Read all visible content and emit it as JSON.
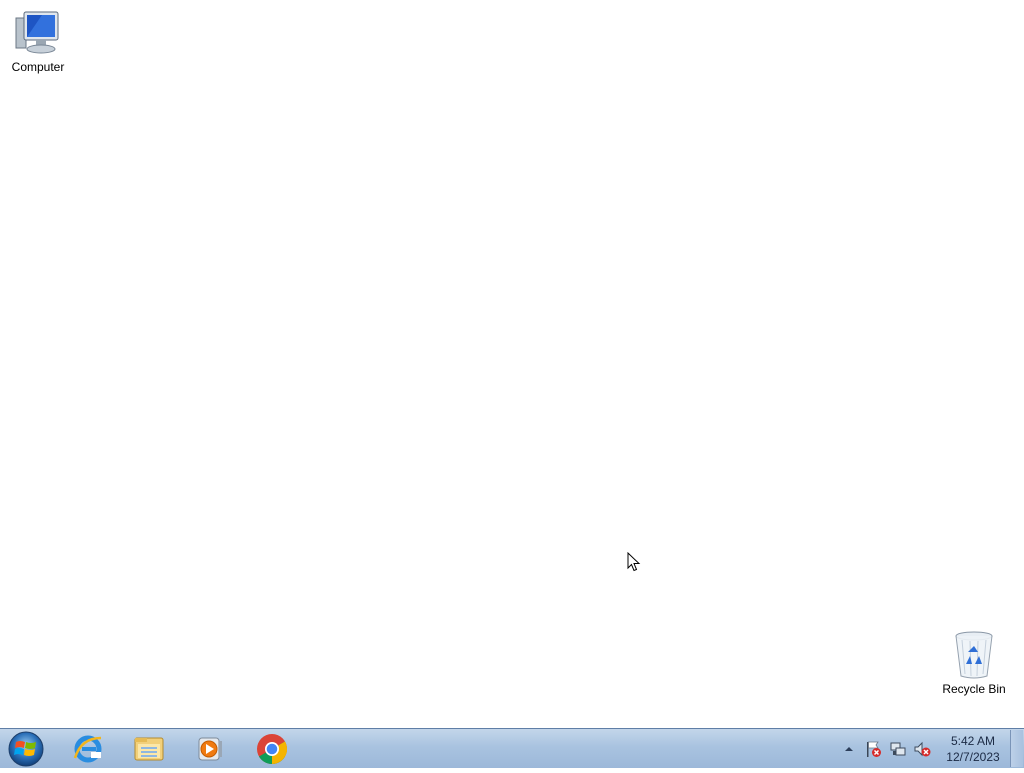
{
  "desktop": {
    "icons": [
      {
        "label": "Computer",
        "icon": "computer-icon"
      },
      {
        "label": "Recycle Bin",
        "icon": "recycle-bin-icon"
      }
    ]
  },
  "taskbar": {
    "start": {
      "icon": "windows-start-orb-icon"
    },
    "pinned": [
      {
        "icon": "internet-explorer-icon"
      },
      {
        "icon": "windows-explorer-icon"
      },
      {
        "icon": "windows-media-player-icon"
      },
      {
        "icon": "google-chrome-icon"
      }
    ],
    "tray": {
      "icons": [
        "show-hidden-icons-icon",
        "action-center-flag-icon",
        "network-icon",
        "volume-muted-icon"
      ],
      "time": "5:42 AM",
      "date": "12/7/2023"
    }
  },
  "colors": {
    "taskbar_top": "#c3d6ea",
    "taskbar_bottom": "#9cb8d9",
    "desktop_background": "#ffffff"
  }
}
